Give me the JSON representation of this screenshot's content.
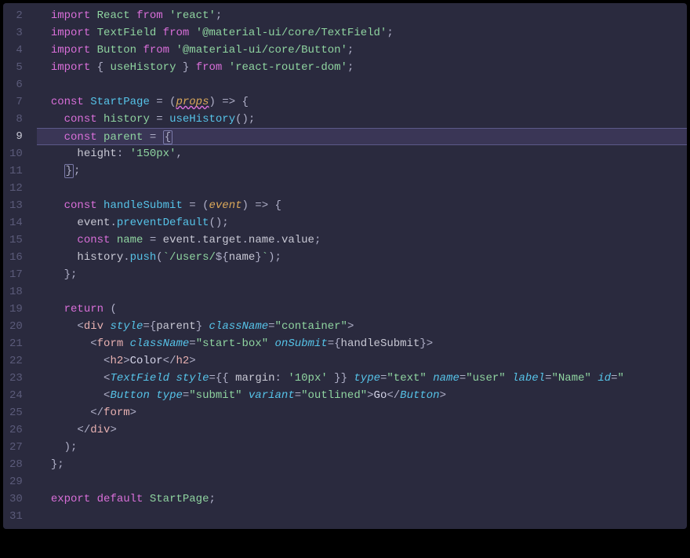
{
  "gutter": {
    "lines": [
      "2",
      "3",
      "4",
      "5",
      "6",
      "7",
      "8",
      "9",
      "10",
      "11",
      "12",
      "13",
      "14",
      "15",
      "16",
      "17",
      "18",
      "19",
      "20",
      "21",
      "22",
      "23",
      "24",
      "25",
      "26",
      "27",
      "28",
      "29",
      "30",
      "31"
    ],
    "current": "9"
  },
  "code": {
    "l2": {
      "import": "import",
      "react": "React",
      "from": "from",
      "mod": "'react'",
      "semi": ";"
    },
    "l3": {
      "import": "import",
      "tf": "TextField",
      "from": "from",
      "mod": "'@material-ui/core/TextField'",
      "semi": ";"
    },
    "l4": {
      "import": "import",
      "btn": "Button",
      "from": "from",
      "mod": "'@material-ui/core/Button'",
      "semi": ";"
    },
    "l5": {
      "import": "import",
      "lb": "{ ",
      "uh": "useHistory",
      "rb": " }",
      "from": "from",
      "mod": "'react-router-dom'",
      "semi": ";"
    },
    "l7": {
      "const": "const",
      "name": "StartPage",
      "eq": " = (",
      "props": "props",
      "arrow": ") => {",
      "close": ""
    },
    "l8": {
      "const": "const",
      "name": "history",
      "eq": " = ",
      "fn": "useHistory",
      "call": "();"
    },
    "l9": {
      "const": "const",
      "name": "parent",
      "eq": " = ",
      "lb": "{"
    },
    "l10": {
      "key": "height",
      "colon": ": ",
      "val": "'150px'",
      "comma": ","
    },
    "l11": {
      "rb": "}",
      "semi": ";"
    },
    "l13": {
      "const": "const",
      "name": "handleSubmit",
      "eq": " = (",
      "event": "event",
      "arrow": ") => {"
    },
    "l14": {
      "obj": "event",
      "dot1": ".",
      "method": "preventDefault",
      "call": "();"
    },
    "l15": {
      "const": "const",
      "name": "name",
      "eq": " = ",
      "obj": "event",
      "d1": ".",
      "p1": "target",
      "d2": ".",
      "p2": "name",
      "d3": ".",
      "p3": "value",
      "semi": ";"
    },
    "l16": {
      "obj": "history",
      "dot": ".",
      "method": "push",
      "open": "(",
      "str1": "`/users/",
      "interp": "${",
      "var": "name",
      "close_interp": "}",
      "str2": "`",
      "close": ");"
    },
    "l17": {
      "rb": "};"
    },
    "l19": {
      "return": "return",
      "open": " ("
    },
    "l20": {
      "open": "<",
      "tag": "div",
      "sp": " ",
      "a1": "style",
      "eq1": "=",
      "v1o": "{",
      "v1": "parent",
      "v1c": "}",
      "sp2": " ",
      "a2": "className",
      "eq2": "=",
      "v2": "\"container\"",
      "close": ">"
    },
    "l21": {
      "open": "<",
      "tag": "form",
      "sp": " ",
      "a1": "className",
      "eq1": "=",
      "v1": "\"start-box\"",
      "sp2": " ",
      "a2": "onSubmit",
      "eq2": "=",
      "v2o": "{",
      "v2": "handleSubmit",
      "v2c": "}",
      "close": ">"
    },
    "l22": {
      "open": "<",
      "tag": "h2",
      "close1": ">",
      "text": "Color",
      "open2": "</",
      "tag2": "h2",
      "close2": ">"
    },
    "l23": {
      "open": "<",
      "comp": "TextField",
      "sp": " ",
      "a1": "style",
      "eq1": "=",
      "v1": "{{ ",
      "k1": "margin",
      "c1": ": ",
      "s1": "'10px'",
      "v1e": " }}",
      "sp2": " ",
      "a2": "type",
      "eq2": "=",
      "v2": "\"text\"",
      "sp3": " ",
      "a3": "name",
      "eq3": "=",
      "v3": "\"user\"",
      "sp4": " ",
      "a4": "label",
      "eq4": "=",
      "v4": "\"Name\"",
      "sp5": " ",
      "a5": "id",
      "eq5": "=",
      "v5": "\""
    },
    "l24": {
      "open": "<",
      "comp": "Button",
      "sp": " ",
      "a1": "type",
      "eq1": "=",
      "v1": "\"submit\"",
      "sp2": " ",
      "a2": "variant",
      "eq2": "=",
      "v2": "\"outlined\"",
      "close1": ">",
      "text": "Go",
      "open2": "</",
      "comp2": "Button",
      "close2": ">"
    },
    "l25": {
      "open": "</",
      "tag": "form",
      "close": ">"
    },
    "l26": {
      "open": "</",
      "tag": "div",
      "close": ">"
    },
    "l27": {
      "close": ");"
    },
    "l28": {
      "close": "};"
    },
    "l30": {
      "export": "export",
      "default": "default",
      "name": "StartPage",
      "semi": ";"
    }
  }
}
